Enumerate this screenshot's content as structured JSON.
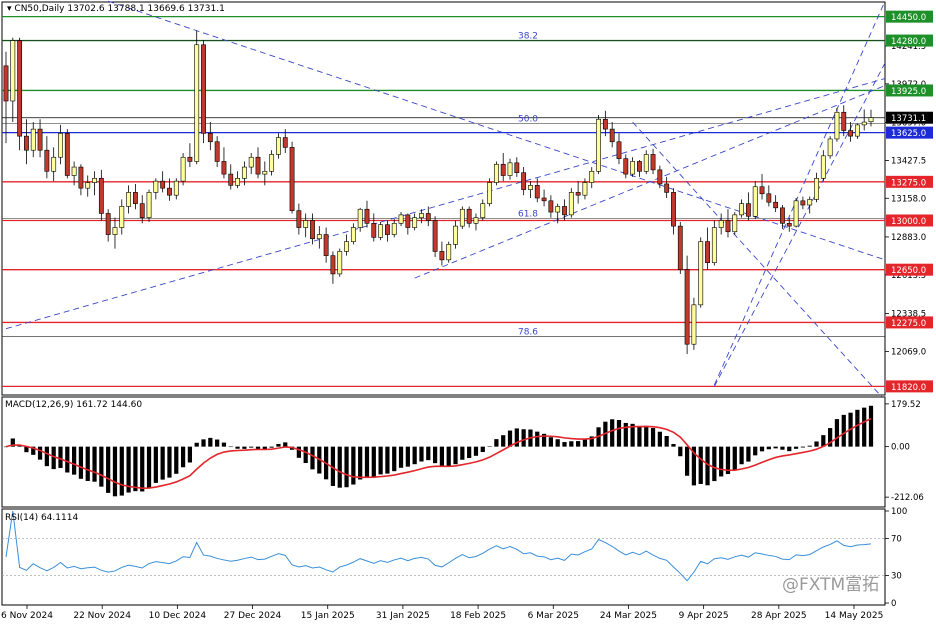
{
  "header": {
    "symbol_line": "CN50,Daily  13702.6 13788.1 13669.6 13731.1"
  },
  "macd_header": "MACD(12,26,9) 161.72 144.60",
  "rsi_header": "RSI(14) 64.1114",
  "watermark": "@FXTM富拓",
  "colors": {
    "up_candle": "#ffff9e",
    "down_candle": "#c0392b",
    "candle_outline": "#000000",
    "support_resistance": "#e3262b",
    "key_level_green": "#1f8f2a",
    "key_level_blue": "#1c2bd6",
    "trendline": "#3a47c8",
    "macd_signal": "#e3262b",
    "macd_histogram": "#000000",
    "rsi_line": "#3a8fd9",
    "label_dark_bg": "#000000",
    "label_red_bg": "#e3262b",
    "label_green_bg": "#1f8f2a",
    "label_blue_bg": "#1c2bd6"
  },
  "chart_data": [
    {
      "type": "candlestick",
      "panel": "price",
      "ylim": [
        11780,
        14540
      ],
      "price_scale_ticks": [
        "14241.5",
        "13972.0",
        "13697.0",
        "13427.5",
        "13158.0",
        "12883.0",
        "12613.5",
        "12338.5",
        "12069.0"
      ],
      "x_labels": [
        "6 Nov 2024",
        "22 Nov 2024",
        "10 Dec 2024",
        "27 Dec 2024",
        "15 Jan 2025",
        "31 Jan 2025",
        "18 Feb 2025",
        "6 Mar 2025",
        "24 Mar 2025",
        "9 Apr 2025",
        "28 Apr 2025",
        "14 May 2025"
      ],
      "levels": [
        {
          "value": 14450,
          "label": "14450.0",
          "color": "green"
        },
        {
          "value": 14280,
          "label": "14280.0",
          "color": "green"
        },
        {
          "value": 13925,
          "label": "13925.0",
          "color": "green"
        },
        {
          "value": 13731.1,
          "label": "13731.1",
          "color": "dark"
        },
        {
          "value": 13625,
          "label": "13625.0",
          "color": "blue"
        },
        {
          "value": 13275,
          "label": "13275.0",
          "color": "red"
        },
        {
          "value": 13000,
          "label": "13000.0",
          "color": "red"
        },
        {
          "value": 12650,
          "label": "12650.0",
          "color": "red"
        },
        {
          "value": 12275,
          "label": "12275.0",
          "color": "red"
        },
        {
          "value": 11820,
          "label": "11820.0",
          "color": "red"
        }
      ],
      "fibonacci": [
        {
          "label": "38.2",
          "value": 14282
        },
        {
          "label": "50.0",
          "value": 13690
        },
        {
          "label": "61.8",
          "value": 13015
        },
        {
          "label": "78.6",
          "value": 12175
        }
      ],
      "ohlc": [
        [
          14100,
          14200,
          13550,
          13850
        ],
        [
          13850,
          14300,
          13700,
          14280
        ],
        [
          14280,
          14300,
          13500,
          13600
        ],
        [
          13600,
          13720,
          13400,
          13500
        ],
        [
          13500,
          13700,
          13450,
          13650
        ],
        [
          13650,
          13720,
          13450,
          13500
        ],
        [
          13500,
          13600,
          13300,
          13350
        ],
        [
          13350,
          13520,
          13280,
          13450
        ],
        [
          13450,
          13680,
          13400,
          13620
        ],
        [
          13620,
          13650,
          13300,
          13320
        ],
        [
          13320,
          13420,
          13250,
          13380
        ],
        [
          13380,
          13400,
          13180,
          13230
        ],
        [
          13230,
          13320,
          13170,
          13270
        ],
        [
          13270,
          13350,
          13180,
          13300
        ],
        [
          13300,
          13360,
          13000,
          13050
        ],
        [
          13050,
          13080,
          12850,
          12900
        ],
        [
          12900,
          13020,
          12800,
          12950
        ],
        [
          12950,
          13150,
          12900,
          13100
        ],
        [
          13100,
          13250,
          13050,
          13200
        ],
        [
          13200,
          13260,
          13080,
          13120
        ],
        [
          13120,
          13180,
          12980,
          13020
        ],
        [
          13020,
          13220,
          12990,
          13200
        ],
        [
          13200,
          13300,
          13150,
          13280
        ],
        [
          13280,
          13350,
          13200,
          13230
        ],
        [
          13230,
          13300,
          13140,
          13180
        ],
        [
          13180,
          13300,
          13150,
          13280
        ],
        [
          13280,
          13480,
          13250,
          13450
        ],
        [
          13450,
          13550,
          13380,
          13420
        ],
        [
          13420,
          14350,
          13400,
          14250
        ],
        [
          14250,
          14280,
          13550,
          13620
        ],
        [
          13620,
          13700,
          13500,
          13560
        ],
        [
          13560,
          13600,
          13380,
          13420
        ],
        [
          13420,
          13520,
          13300,
          13330
        ],
        [
          13330,
          13400,
          13220,
          13250
        ],
        [
          13250,
          13350,
          13230,
          13300
        ],
        [
          13300,
          13420,
          13250,
          13380
        ],
        [
          13380,
          13480,
          13330,
          13450
        ],
        [
          13450,
          13520,
          13300,
          13330
        ],
        [
          13330,
          13420,
          13250,
          13350
        ],
        [
          13350,
          13500,
          13320,
          13470
        ],
        [
          13470,
          13620,
          13440,
          13590
        ],
        [
          13590,
          13650,
          13480,
          13520
        ],
        [
          13520,
          13560,
          13050,
          13070
        ],
        [
          13070,
          13120,
          12900,
          12950
        ],
        [
          12950,
          13050,
          12880,
          13000
        ],
        [
          13000,
          13050,
          12830,
          12870
        ],
        [
          12870,
          12960,
          12800,
          12900
        ],
        [
          12900,
          12950,
          12700,
          12750
        ],
        [
          12750,
          12780,
          12550,
          12620
        ],
        [
          12620,
          12800,
          12600,
          12780
        ],
        [
          12780,
          12900,
          12750,
          12850
        ],
        [
          12850,
          12980,
          12830,
          12950
        ],
        [
          12950,
          13090,
          12920,
          13080
        ],
        [
          13080,
          13140,
          12950,
          12980
        ],
        [
          12980,
          13050,
          12850,
          12880
        ],
        [
          12880,
          12990,
          12860,
          12970
        ],
        [
          12970,
          13000,
          12850,
          12900
        ],
        [
          12900,
          13010,
          12880,
          12980
        ],
        [
          12980,
          13060,
          12960,
          13040
        ],
        [
          13040,
          13050,
          12900,
          12950
        ],
        [
          12950,
          13050,
          12930,
          13020
        ],
        [
          13020,
          13080,
          12980,
          13050
        ],
        [
          13050,
          13100,
          12960,
          13000
        ],
        [
          13000,
          13030,
          12740,
          12780
        ],
        [
          12780,
          12850,
          12680,
          12720
        ],
        [
          12720,
          12850,
          12700,
          12830
        ],
        [
          12830,
          13000,
          12800,
          12960
        ],
        [
          12960,
          13100,
          12940,
          13080
        ],
        [
          13080,
          13100,
          12950,
          12980
        ],
        [
          12980,
          13050,
          12930,
          13020
        ],
        [
          13020,
          13150,
          13000,
          13120
        ],
        [
          13120,
          13300,
          13100,
          13270
        ],
        [
          13270,
          13420,
          13250,
          13400
        ],
        [
          13400,
          13480,
          13280,
          13320
        ],
        [
          13320,
          13440,
          13290,
          13410
        ],
        [
          13410,
          13450,
          13310,
          13340
        ],
        [
          13340,
          13380,
          13180,
          13220
        ],
        [
          13220,
          13280,
          13160,
          13250
        ],
        [
          13250,
          13300,
          13130,
          13160
        ],
        [
          13160,
          13220,
          13100,
          13140
        ],
        [
          13140,
          13180,
          13020,
          13060
        ],
        [
          13060,
          13120,
          12980,
          13100
        ],
        [
          13100,
          13150,
          13000,
          13040
        ],
        [
          13040,
          13230,
          13020,
          13200
        ],
        [
          13200,
          13280,
          13120,
          13180
        ],
        [
          13180,
          13300,
          13150,
          13270
        ],
        [
          13270,
          13380,
          13230,
          13350
        ],
        [
          13350,
          13750,
          13330,
          13720
        ],
        [
          13720,
          13780,
          13600,
          13650
        ],
        [
          13650,
          13700,
          13520,
          13560
        ],
        [
          13560,
          13620,
          13400,
          13440
        ],
        [
          13440,
          13470,
          13300,
          13330
        ],
        [
          13330,
          13450,
          13310,
          13420
        ],
        [
          13420,
          13430,
          13310,
          13350
        ],
        [
          13350,
          13500,
          13330,
          13470
        ],
        [
          13470,
          13510,
          13330,
          13360
        ],
        [
          13360,
          13390,
          13230,
          13260
        ],
        [
          13260,
          13310,
          13160,
          13200
        ],
        [
          13200,
          13230,
          12900,
          12960
        ],
        [
          12960,
          12990,
          12620,
          12650
        ],
        [
          12650,
          12750,
          12050,
          12120
        ],
        [
          12120,
          12450,
          12080,
          12400
        ],
        [
          12400,
          12880,
          12380,
          12850
        ],
        [
          12850,
          12950,
          12650,
          12700
        ],
        [
          12700,
          13000,
          12680,
          12950
        ],
        [
          12950,
          13050,
          12900,
          13000
        ],
        [
          13000,
          13080,
          12880,
          12920
        ],
        [
          12920,
          13060,
          12900,
          13040
        ],
        [
          13040,
          13150,
          13020,
          13120
        ],
        [
          13120,
          13200,
          13000,
          13030
        ],
        [
          13030,
          13280,
          13010,
          13240
        ],
        [
          13240,
          13330,
          13150,
          13190
        ],
        [
          13190,
          13250,
          13100,
          13130
        ],
        [
          13130,
          13180,
          13060,
          13090
        ],
        [
          13090,
          13110,
          12940,
          12980
        ],
        [
          12980,
          13020,
          12920,
          12960
        ],
        [
          12960,
          13160,
          12950,
          13140
        ],
        [
          13140,
          13170,
          13080,
          13110
        ],
        [
          13110,
          13170,
          13050,
          13150
        ],
        [
          13150,
          13340,
          13130,
          13300
        ],
        [
          13300,
          13500,
          13280,
          13460
        ],
        [
          13460,
          13600,
          13440,
          13580
        ],
        [
          13580,
          13800,
          13560,
          13770
        ],
        [
          13770,
          13820,
          13600,
          13640
        ],
        [
          13640,
          13700,
          13560,
          13600
        ],
        [
          13600,
          13690,
          13580,
          13680
        ],
        [
          13680,
          13790,
          13640,
          13700
        ],
        [
          13702.6,
          13788.1,
          13669.6,
          13731.1
        ]
      ]
    },
    {
      "type": "macd",
      "panel": "macd",
      "params": "12,26,9",
      "ylim": [
        -245,
        200
      ],
      "scale_ticks": [
        "179.52",
        "0.00",
        "-212.06"
      ]
    },
    {
      "type": "line",
      "panel": "rsi",
      "params": "14",
      "ylim": [
        0,
        100
      ],
      "scale_ticks": [
        "100",
        "70",
        "30",
        "0"
      ]
    }
  ]
}
